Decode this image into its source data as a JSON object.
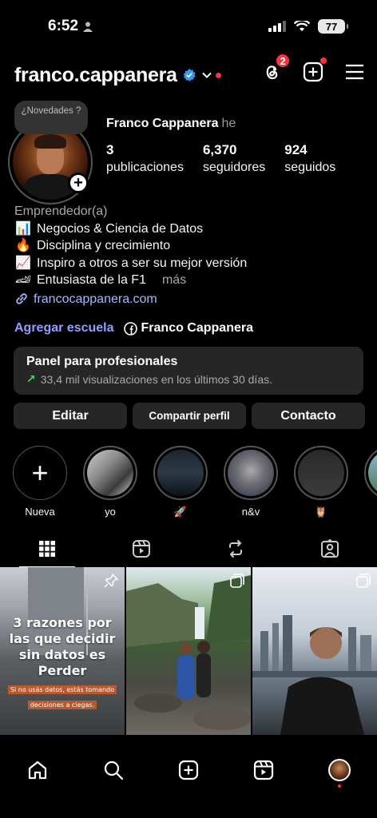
{
  "status": {
    "time": "6:52",
    "battery": "77"
  },
  "header": {
    "username": "franco.cappanera",
    "threads_badge": "2"
  },
  "profile": {
    "novedades": "¿Novedades ?",
    "name": "Franco Cappanera",
    "pronoun": "he",
    "stats": [
      {
        "num": "3",
        "label": "publicaciones"
      },
      {
        "num": "6,370",
        "label": "seguidores"
      },
      {
        "num": "924",
        "label": "seguidos"
      }
    ]
  },
  "bio": {
    "category": "Emprendedor(a)",
    "lines": [
      {
        "emoji": "📊",
        "text": "Negocios & Ciencia de Datos"
      },
      {
        "emoji": "🔥",
        "text": "Disciplina y crecimiento"
      },
      {
        "emoji": "📈",
        "text": "Inspiro a otros a ser su mejor versión"
      },
      {
        "emoji": "🏎",
        "text": "Entusiasta de la F1"
      }
    ],
    "more": "más",
    "link": "francocappanera.com"
  },
  "links": {
    "school": "Agregar escuela",
    "facebook": "Franco Cappanera"
  },
  "panel": {
    "title": "Panel para profesionales",
    "subtitle": "33,4 mil visualizaciones en los últimos 30 días."
  },
  "buttons": {
    "edit": "Editar",
    "share": "Compartir perfil",
    "contact": "Contacto"
  },
  "highlights": [
    {
      "label": "Nueva"
    },
    {
      "label": "yo"
    },
    {
      "label": "🚀"
    },
    {
      "label": "n&v"
    },
    {
      "label": "🦉"
    }
  ],
  "post1": {
    "line1": "3 razones por las que decidir sin datos es Perder",
    "line2": "Si no usás datos, estás tomando",
    "line3": "decisiones a ciegas."
  },
  "colors": {
    "accent_link": "#a3b8ff",
    "badge_red": "#ff3040",
    "panel_bg": "#262626",
    "verified_blue": "#3897f0"
  }
}
